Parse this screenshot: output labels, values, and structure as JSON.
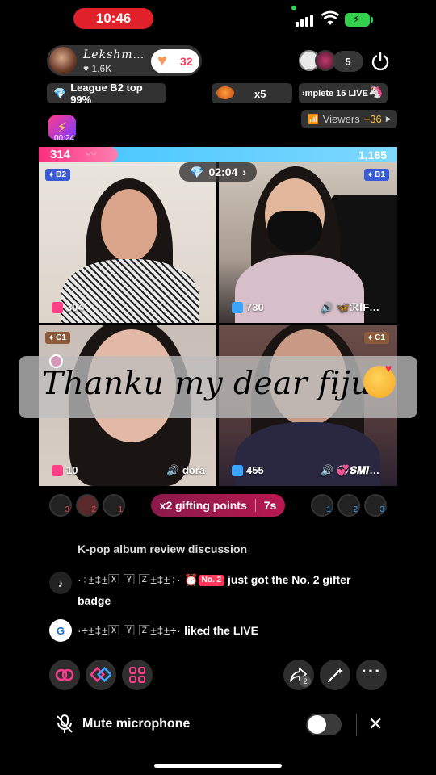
{
  "status_bar": {
    "time": "10:46"
  },
  "host": {
    "name": "Lekshm…",
    "likes": "1.6K",
    "follow_count": "32"
  },
  "viewers_top": {
    "count": "5"
  },
  "info_row": {
    "league": "League B2 top 99%",
    "multiplier": "x5",
    "task": "›mplete 15 LIVE"
  },
  "viewers_pill": {
    "label": "Viewers",
    "delta": "+36"
  },
  "lightning": {
    "time": "00:24"
  },
  "battle": {
    "left_score": "314",
    "right_score": "1,185",
    "timer": "02:04"
  },
  "tiles": [
    {
      "tier": "B2",
      "score": "304",
      "name": ""
    },
    {
      "tier": "B1",
      "score": "730",
      "name": "🦋ℛ𝐈F…"
    },
    {
      "tier": "C1",
      "score": "10",
      "name": "dora"
    },
    {
      "tier": "C1",
      "score": "455",
      "name": "💞𝑺𝑴𝑰…"
    }
  ],
  "banner": {
    "text": "Thanku my dear fijuu"
  },
  "gift_row": {
    "label": "x2 gifting points",
    "timer": "7s",
    "left_ranks": [
      "3",
      "2",
      "1"
    ],
    "right_ranks": [
      "1",
      "2",
      "3"
    ]
  },
  "chat": {
    "faded": "K-pop album review discussion",
    "messages": [
      {
        "user": "·÷±‡±🅇 🅈 🅉±‡±÷·",
        "badge": "No. 2",
        "text": "just got the No. 2 gifter badge"
      },
      {
        "user": "·÷±‡±🅇 🅈 🅉±‡±÷·",
        "text": "liked the LIVE"
      }
    ]
  },
  "actions": {
    "share_count": "2"
  },
  "mic_bar": {
    "label": "Mute microphone"
  },
  "colors": {
    "accent_pink": "#ff3b5c",
    "battle_pink": "#ff2f7e",
    "battle_blue": "#3fc4ff",
    "gift_pill": "#b8184f"
  }
}
